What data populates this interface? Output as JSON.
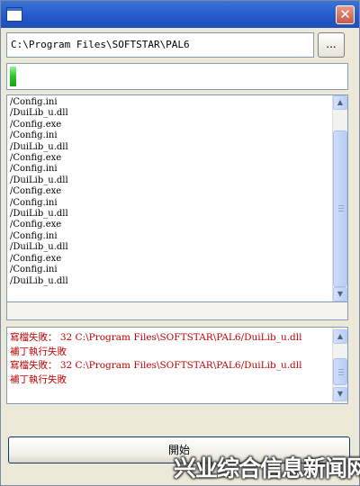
{
  "window": {
    "title": ""
  },
  "path_field": {
    "value": "C:\\Program Files\\SOFTSTAR\\PAL6"
  },
  "browse_button": {
    "label": "..."
  },
  "progress": {
    "value_percent": 2
  },
  "file_list": {
    "items": [
      "/Config.ini",
      "/DuiLib_u.dll",
      "/Config.exe",
      "/Config.ini",
      "/DuiLib_u.dll",
      "/Config.exe",
      "/Config.ini",
      "/DuiLib_u.dll",
      "/Config.exe",
      "/Config.ini",
      "/DuiLib_u.dll",
      "/Config.exe",
      "/Config.ini",
      "/DuiLib_u.dll",
      "/Config.exe",
      "/Config.ini",
      "/DuiLib_u.dll"
    ]
  },
  "log": {
    "color": "#c00000",
    "lines": [
      "寫檔失敗： 32 C:\\Program Files\\SOFTSTAR\\PAL6/DuiLib_u.dll",
      "補丁執行失敗",
      "寫檔失敗： 32 C:\\Program Files\\SOFTSTAR\\PAL6/DuiLib_u.dll",
      "補丁執行失敗"
    ]
  },
  "start_button": {
    "label": "開始"
  },
  "watermark": {
    "text": "兴业综合信息新闻网"
  }
}
